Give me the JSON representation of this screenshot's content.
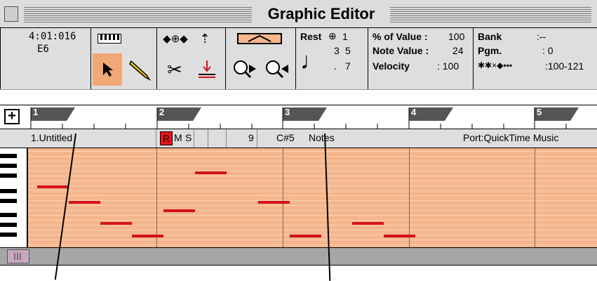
{
  "window": {
    "title": "Graphic Editor"
  },
  "position": {
    "time": "4:01:016",
    "pitch": "E6"
  },
  "step": {
    "row1a": "1",
    "row2a": "3",
    "row2b": "5",
    "row3a": ".",
    "row3b": "7"
  },
  "rest_label": "Rest",
  "params": {
    "pct_label": "% of Value :",
    "pct_value": "100",
    "note_value_label": "Note Value :",
    "note_value": "24",
    "velocity_label": "Velocity",
    "velocity_value": ": 100",
    "bank_label": "Bank",
    "bank_value": ":--",
    "pgm_label": "Pgm.",
    "pgm_value": ": 0",
    "vel_range": ":100-121"
  },
  "ruler": {
    "bars": [
      "1",
      "2",
      "3",
      "4",
      "5"
    ]
  },
  "track": {
    "name": "1.Untitled",
    "rec_btn": "R",
    "mute_btn": "M",
    "solo_btn": "S",
    "channel": "9",
    "pitch": "C#5",
    "view": "Notes",
    "port": "Port:QuickTime Music"
  },
  "colors": {
    "note": "#d4111a",
    "grid": "#f5b68c",
    "selected_tool": "#f0a878"
  }
}
